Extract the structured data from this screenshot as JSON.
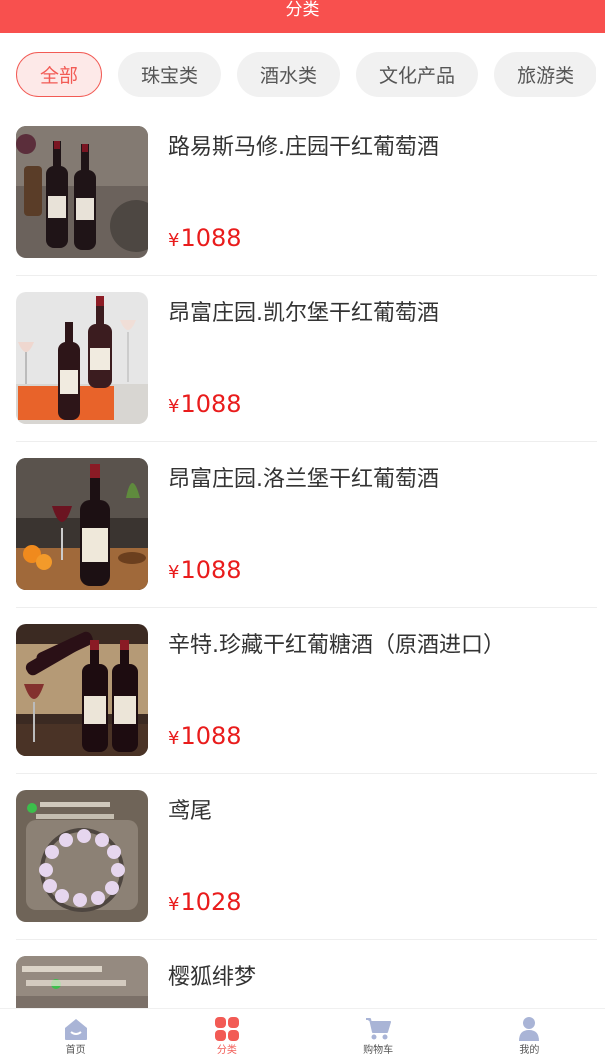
{
  "header": {
    "title": "分类"
  },
  "categories": [
    {
      "label": "全部",
      "active": true
    },
    {
      "label": "珠宝类",
      "active": false
    },
    {
      "label": "酒水类",
      "active": false
    },
    {
      "label": "文化产品",
      "active": false
    },
    {
      "label": "旅游类",
      "active": false
    }
  ],
  "products": [
    {
      "name": "路易斯马修.庄园干红葡萄酒",
      "currency": "¥",
      "price": "1088"
    },
    {
      "name": "昂富庄园.凯尔堡干红葡萄酒",
      "currency": "¥",
      "price": "1088"
    },
    {
      "name": "昂富庄园.洛兰堡干红葡萄酒",
      "currency": "¥",
      "price": "1088"
    },
    {
      "name": "辛特.珍藏干红葡糖酒（原酒进口）",
      "currency": "¥",
      "price": "1088"
    },
    {
      "name": "鸢尾",
      "currency": "¥",
      "price": "1028"
    },
    {
      "name": "樱狐绯梦",
      "currency": "¥",
      "price": ""
    }
  ],
  "tabbar": [
    {
      "label": "首页",
      "icon": "home-icon",
      "active": false
    },
    {
      "label": "分类",
      "icon": "category-icon",
      "active": true
    },
    {
      "label": "购物车",
      "icon": "cart-icon",
      "active": false
    },
    {
      "label": "我的",
      "icon": "user-icon",
      "active": false
    }
  ],
  "colors": {
    "accent": "#f8504e",
    "price": "#e91c1c",
    "tab_inactive_icon": "#a9b4d6"
  }
}
